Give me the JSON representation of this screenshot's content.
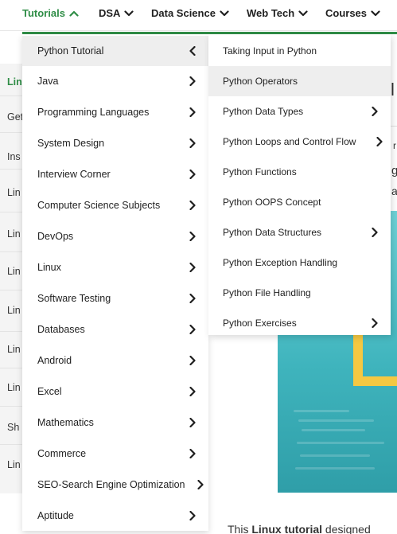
{
  "nav": {
    "items": [
      {
        "label": "Tutorials",
        "state": "open"
      },
      {
        "label": "DSA"
      },
      {
        "label": "Data Science"
      },
      {
        "label": "Web Tech"
      },
      {
        "label": "Courses"
      }
    ]
  },
  "menu": {
    "level1": [
      {
        "label": "Python Tutorial",
        "active": true
      },
      {
        "label": "Java"
      },
      {
        "label": "Programming Languages"
      },
      {
        "label": "System Design"
      },
      {
        "label": "Interview Corner"
      },
      {
        "label": "Computer Science Subjects"
      },
      {
        "label": "DevOps"
      },
      {
        "label": "Linux"
      },
      {
        "label": "Software Testing"
      },
      {
        "label": "Databases"
      },
      {
        "label": "Android"
      },
      {
        "label": "Excel"
      },
      {
        "label": "Mathematics"
      },
      {
        "label": "Commerce"
      },
      {
        "label": "SEO-Search Engine Optimization"
      },
      {
        "label": "Aptitude"
      }
    ],
    "level2": [
      {
        "label": "Taking Input in Python",
        "has_submenu": false
      },
      {
        "label": "Python Operators",
        "has_submenu": false,
        "active": true
      },
      {
        "label": "Python Data Types",
        "has_submenu": true
      },
      {
        "label": "Python Loops and Control Flow",
        "has_submenu": true
      },
      {
        "label": "Python Functions",
        "has_submenu": false
      },
      {
        "label": "Python OOPS Concept",
        "has_submenu": false
      },
      {
        "label": "Python Data Structures",
        "has_submenu": true
      },
      {
        "label": "Python Exception Handling",
        "has_submenu": false
      },
      {
        "label": "Python File Handling",
        "has_submenu": false
      },
      {
        "label": "Python Exercises",
        "has_submenu": true
      }
    ]
  },
  "background": {
    "sidebar_items": [
      "Lin",
      "Get",
      "Ins",
      "Lin",
      "Lin",
      "Lin",
      "Lin",
      "Lin",
      "Lin",
      "Sh",
      "Lin"
    ],
    "right_fragments": [
      "l",
      "r",
      "g",
      "a"
    ],
    "paragraph": {
      "before": "This ",
      "bold": "Linux tutorial",
      "after": " designed"
    }
  },
  "colors": {
    "accent": "#2f8d46",
    "hover_bg": "#eeeeee",
    "hero": "#3fb4bd",
    "hero_frame": "#f5c842"
  },
  "icons": {
    "nav_open": "chevron-up-icon",
    "nav_closed": "chevron-down-icon",
    "menu_active": "chevron-left-icon",
    "menu_item": "chevron-right-icon"
  }
}
